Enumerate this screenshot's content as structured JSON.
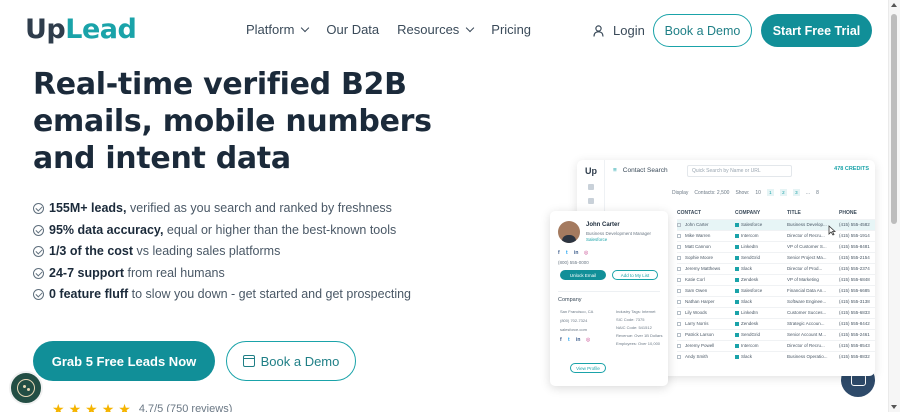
{
  "header": {
    "logo": {
      "part1": "Up",
      "part2": "Lead"
    },
    "nav": [
      {
        "label": "Platform",
        "dropdown": true
      },
      {
        "label": "Our Data",
        "dropdown": false
      },
      {
        "label": "Resources",
        "dropdown": true
      },
      {
        "label": "Pricing",
        "dropdown": false
      }
    ],
    "login_label": "Login",
    "book_demo_label": "Book a Demo",
    "start_trial_label": "Start Free Trial"
  },
  "hero": {
    "headline": "Real-time verified B2B emails, mobile numbers and intent data",
    "bullets": [
      {
        "bold": "155M+ leads,",
        "rest": " verified as you search and ranked by freshness"
      },
      {
        "bold": "95% data accuracy,",
        "rest": " equal or higher than the best-known tools"
      },
      {
        "bold": "1/3 of the cost",
        "rest": " vs leading sales platforms"
      },
      {
        "bold": "24-7 support",
        "rest": " from real humans"
      },
      {
        "bold": "0 feature fluff",
        "rest": " to slow you down - get started and get prospecting"
      }
    ],
    "cta_primary": "Grab 5 Free Leads Now",
    "cta_secondary": "Book a Demo",
    "rating_text": "4.7/5 (750 reviews)",
    "stars": 5
  },
  "mockup": {
    "logo": "Up",
    "title": "Contact Search",
    "search_placeholder": "Quick Search by Name or URL",
    "credits": "478 CREDITS",
    "display_label": "Display",
    "contacts_label": "Contacts: 2,500",
    "show_label": "Show:",
    "show_value": "10",
    "pages": [
      "1",
      "2",
      "3",
      "...",
      "8"
    ],
    "columns": [
      "CONTACT",
      "COMPANY",
      "TITLE",
      "PHONE"
    ],
    "rows": [
      {
        "contact": "John Carter",
        "company": "Salesforce",
        "title": "Business Develop...",
        "phone": "(415) 555-4582",
        "highlight": true
      },
      {
        "contact": "Mike Warren",
        "company": "Intercom",
        "title": "Director of Recru...",
        "phone": "(415) 555-1914",
        "highlight": false
      },
      {
        "contact": "Matt Cannon",
        "company": "LinkedIn",
        "title": "VP of Customer S...",
        "phone": "(415) 555-8481",
        "highlight": false
      },
      {
        "contact": "Sophie Moore",
        "company": "SendGrid",
        "title": "Senior Project Ma...",
        "phone": "(415) 555-2154",
        "highlight": false
      },
      {
        "contact": "Jeremy Matthews",
        "company": "Slack",
        "title": "Director of Prod...",
        "phone": "(415) 555-2374",
        "highlight": false
      },
      {
        "contact": "Katie Corl",
        "company": "Zendesk",
        "title": "VP of Marketing",
        "phone": "(415) 555-6848",
        "highlight": false
      },
      {
        "contact": "Sam Owen",
        "company": "Salesforce",
        "title": "Financial Data An...",
        "phone": "(415) 555-6685",
        "highlight": false
      },
      {
        "contact": "Nathan Harper",
        "company": "Slack",
        "title": "Software Enginee...",
        "phone": "(415) 555-3138",
        "highlight": false
      },
      {
        "contact": "Lily Woods",
        "company": "LinkedIn",
        "title": "Customer Succes...",
        "phone": "(415) 555-6833",
        "highlight": false
      },
      {
        "contact": "Larry Norris",
        "company": "Zendesk",
        "title": "Strategic Accoun...",
        "phone": "(415) 555-8442",
        "highlight": false
      },
      {
        "contact": "Patrick Larson",
        "company": "SendGrid",
        "title": "Senior Account M...",
        "phone": "(415) 555-2461",
        "highlight": false
      },
      {
        "contact": "Jeremy Powell",
        "company": "Intercom",
        "title": "Director of Recru...",
        "phone": "(415) 555-8543",
        "highlight": false
      },
      {
        "contact": "Andy Smith",
        "company": "Slack",
        "title": "Business Operatio...",
        "phone": "(415) 555-8832",
        "highlight": false
      }
    ]
  },
  "card": {
    "name": "John Carter",
    "title": "Business Development Manager",
    "company": "Salesforce",
    "phone": "(800) 555-0000",
    "unlock_label": "Unlock Email",
    "list_label": "Add to My List",
    "company_heading": "Company",
    "left_info": [
      "San Francisco, CA",
      "(800) 702-7324",
      "salesforce.com"
    ],
    "right_info": [
      "Industry Tags: Internet",
      "SIC Code: 7375",
      "NAIC Code: 541512",
      "Revenue: Over 1B Dollars",
      "Employees: Over 10,000"
    ],
    "view_label": "View Profile"
  },
  "colors": {
    "brand_teal": "#118f98",
    "accent_teal": "#1aa3a9",
    "headline": "#1b2a3a",
    "star": "#f5b400"
  },
  "icons": [
    "user-icon",
    "chevron-down-icon",
    "check-circle-icon",
    "calendar-icon",
    "star-icon",
    "cookie-icon",
    "chat-icon",
    "cursor-icon"
  ]
}
